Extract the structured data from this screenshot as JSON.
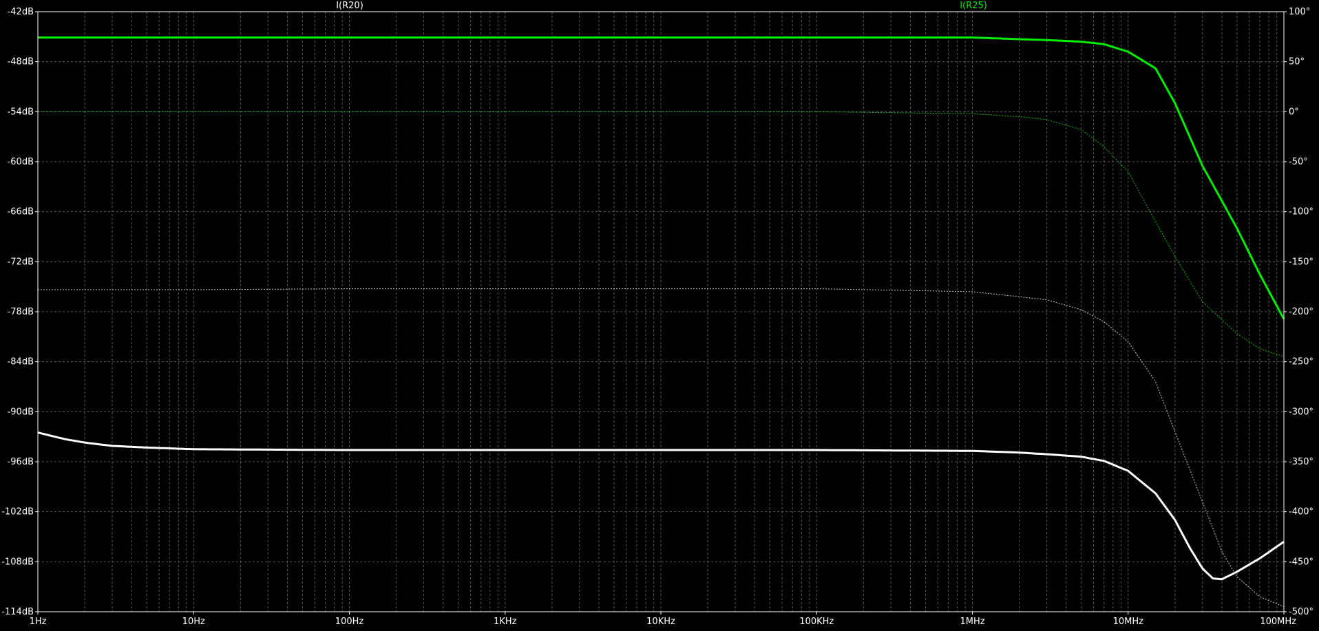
{
  "chart_data": {
    "type": "line",
    "xscale": "log",
    "xlim": [
      1,
      100000000
    ],
    "x_ticks": [
      {
        "v": 1,
        "label": "1Hz"
      },
      {
        "v": 10,
        "label": "10Hz"
      },
      {
        "v": 100,
        "label": "100Hz"
      },
      {
        "v": 1000,
        "label": "1KHz"
      },
      {
        "v": 10000,
        "label": "10KHz"
      },
      {
        "v": 100000,
        "label": "100KHz"
      },
      {
        "v": 1000000,
        "label": "1MHz"
      },
      {
        "v": 10000000,
        "label": "10MHz"
      },
      {
        "v": 100000000,
        "label": "100MHz"
      }
    ],
    "ylim_left": [
      -114,
      -42
    ],
    "y_ticks_left": [
      {
        "v": -42,
        "label": "-42dB"
      },
      {
        "v": -48,
        "label": "-48dB"
      },
      {
        "v": -54,
        "label": "-54dB"
      },
      {
        "v": -60,
        "label": "-60dB"
      },
      {
        "v": -66,
        "label": "-66dB"
      },
      {
        "v": -72,
        "label": "-72dB"
      },
      {
        "v": -78,
        "label": "-78dB"
      },
      {
        "v": -84,
        "label": "-84dB"
      },
      {
        "v": -90,
        "label": "-90dB"
      },
      {
        "v": -96,
        "label": "-96dB"
      },
      {
        "v": -102,
        "label": "-102dB"
      },
      {
        "v": -108,
        "label": "-108dB"
      },
      {
        "v": -114,
        "label": "-114dB"
      }
    ],
    "ylim_right": [
      -500,
      100
    ],
    "y_ticks_right": [
      {
        "v": 100,
        "label": "100°"
      },
      {
        "v": 50,
        "label": "50°"
      },
      {
        "v": 0,
        "label": "0°"
      },
      {
        "v": -50,
        "label": "-50°"
      },
      {
        "v": -100,
        "label": "-100°"
      },
      {
        "v": -150,
        "label": "-150°"
      },
      {
        "v": -200,
        "label": "-200°"
      },
      {
        "v": -250,
        "label": "-250°"
      },
      {
        "v": -300,
        "label": "-300°"
      },
      {
        "v": -350,
        "label": "-350°"
      },
      {
        "v": -400,
        "label": "-400°"
      },
      {
        "v": -450,
        "label": "-450°"
      },
      {
        "v": -500,
        "label": "-500°"
      }
    ],
    "grid": true,
    "series": [
      {
        "name": "I(R20)",
        "color": "#ffffff",
        "magnitude_db": [
          [
            1,
            -92.5
          ],
          [
            1.5,
            -93.3
          ],
          [
            2,
            -93.7
          ],
          [
            3,
            -94.1
          ],
          [
            5,
            -94.3
          ],
          [
            10,
            -94.5
          ],
          [
            100,
            -94.6
          ],
          [
            1000,
            -94.6
          ],
          [
            10000,
            -94.6
          ],
          [
            100000,
            -94.6
          ],
          [
            1000000,
            -94.7
          ],
          [
            2000000,
            -94.9
          ],
          [
            3000000,
            -95.1
          ],
          [
            5000000,
            -95.4
          ],
          [
            7000000,
            -95.9
          ],
          [
            10000000,
            -97.1
          ],
          [
            15000000,
            -99.8
          ],
          [
            20000000,
            -103.0
          ],
          [
            25000000,
            -106.4
          ],
          [
            30000000,
            -108.8
          ],
          [
            35000000,
            -110.0
          ],
          [
            40000000,
            -110.1
          ],
          [
            50000000,
            -109.2
          ],
          [
            70000000,
            -107.6
          ],
          [
            100000000,
            -105.6
          ]
        ],
        "phase_deg": [
          [
            1,
            -178
          ],
          [
            10,
            -178
          ],
          [
            100,
            -177
          ],
          [
            1000,
            -177
          ],
          [
            10000,
            -177
          ],
          [
            100000,
            -177
          ],
          [
            1000000,
            -180
          ],
          [
            3000000,
            -188
          ],
          [
            5000000,
            -198
          ],
          [
            7000000,
            -210
          ],
          [
            10000000,
            -230
          ],
          [
            15000000,
            -270
          ],
          [
            20000000,
            -320
          ],
          [
            30000000,
            -390
          ],
          [
            40000000,
            -440
          ],
          [
            50000000,
            -465
          ],
          [
            70000000,
            -485
          ],
          [
            100000000,
            -495
          ]
        ]
      },
      {
        "name": "I(R25)",
        "color": "#00ee00",
        "magnitude_db": [
          [
            1,
            -45.1
          ],
          [
            10,
            -45.1
          ],
          [
            100,
            -45.1
          ],
          [
            1000,
            -45.1
          ],
          [
            10000,
            -45.1
          ],
          [
            100000,
            -45.1
          ],
          [
            1000000,
            -45.1
          ],
          [
            2000000,
            -45.3
          ],
          [
            3000000,
            -45.4
          ],
          [
            5000000,
            -45.6
          ],
          [
            7000000,
            -45.9
          ],
          [
            10000000,
            -46.8
          ],
          [
            15000000,
            -48.8
          ],
          [
            20000000,
            -53.0
          ],
          [
            30000000,
            -60.5
          ],
          [
            50000000,
            -68.0
          ],
          [
            70000000,
            -73.5
          ],
          [
            100000000,
            -78.9
          ]
        ],
        "phase_deg": [
          [
            1,
            0
          ],
          [
            100000,
            0
          ],
          [
            1000000,
            -2
          ],
          [
            2000000,
            -5
          ],
          [
            3000000,
            -8
          ],
          [
            5000000,
            -18
          ],
          [
            7000000,
            -35
          ],
          [
            10000000,
            -60
          ],
          [
            15000000,
            -110
          ],
          [
            20000000,
            -145
          ],
          [
            30000000,
            -190
          ],
          [
            50000000,
            -222
          ],
          [
            70000000,
            -237
          ],
          [
            100000000,
            -245
          ]
        ]
      }
    ]
  }
}
